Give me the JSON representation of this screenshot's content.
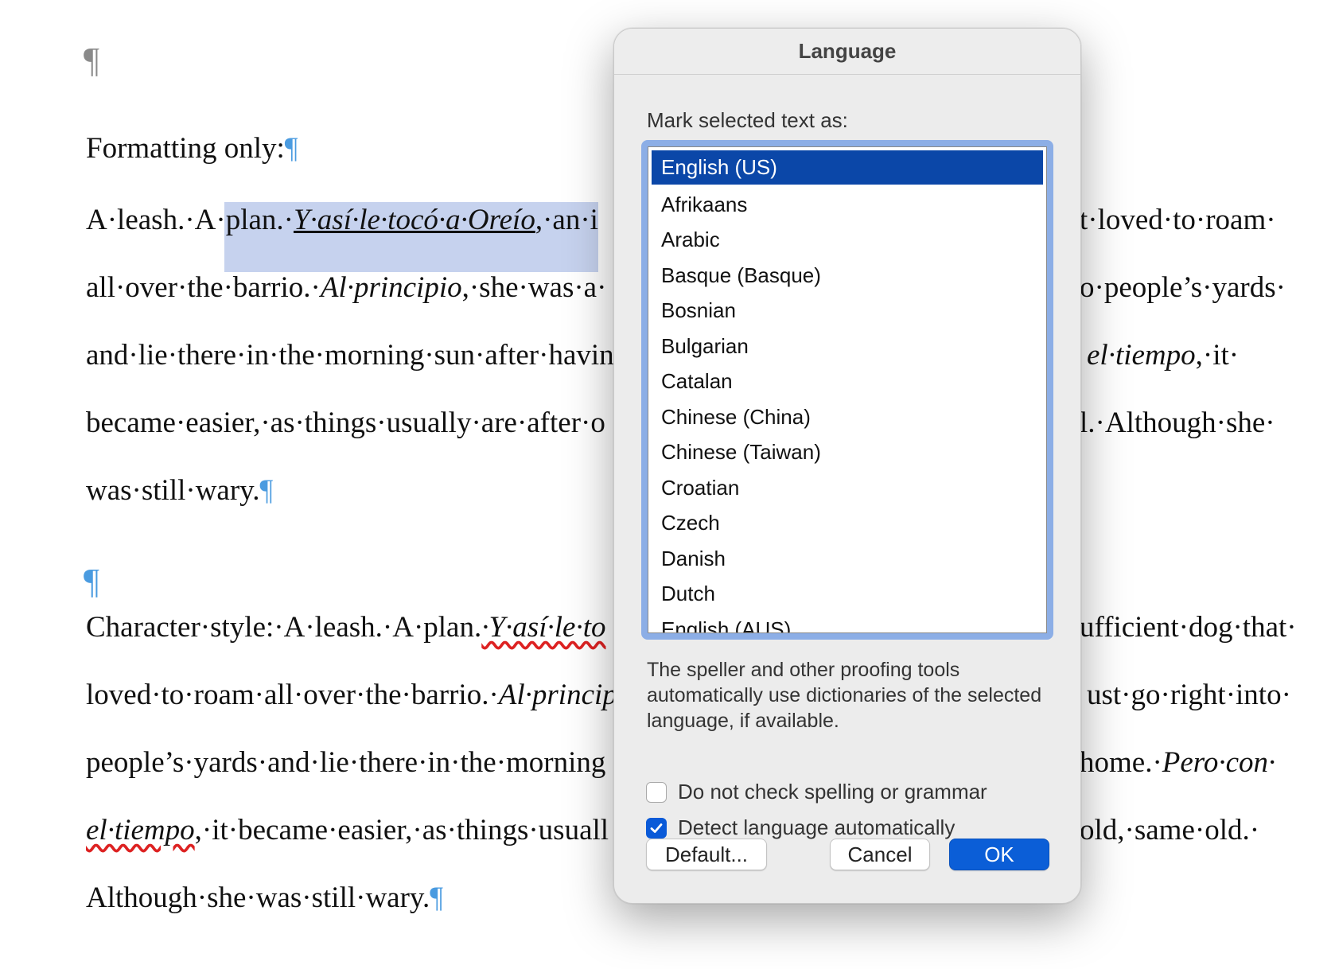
{
  "document": {
    "top_pilcrow": "¶",
    "heading": "Formatting only:",
    "para1": {
      "l1_a": "A·leash.·A·",
      "l1_sel_plain": "plan.·",
      "l1_sel_italic": "Y·así·le·tocó·a·Oreío",
      "l1_b": ",·an·i",
      "l1_right": "t·loved·to·roam·",
      "l2_a": "all·over·the·barrio.·",
      "l2_italic": "Al·principio",
      "l2_b": ",·she·was·a·",
      "l2_right": "o·people’s·yards·",
      "l3_a": "and·lie·there·in·the·morning·sun·after·havin",
      "l3_right_italic": "el·tiempo",
      "l3_right_b": ",·it·",
      "l4_a": "became·easier,·as·things·usually·are·after·o",
      "l4_right": "l.·Although·she·",
      "l5": "was·still·wary."
    },
    "blank_pilcrow": "¶",
    "para2": {
      "l1_a": "Character·style:·A·leash.·A·plan.",
      "l1_italic": "·Y·así·le·to",
      "l1_right": "ufficient·dog·that·",
      "l2_a": "loved·to·roam·all·over·the·barrio.·",
      "l2_italic": "Al·princip",
      "l2_right": "ust·go·right·into·",
      "l3_a": "people’s·yards·and·lie·there·in·the·morning",
      "l3_right": "home.·",
      "l3_right_italic": "Pero·con·",
      "l4_italic": "el·tiempo",
      "l4_b": ",·it·became·easier,·as·things·usuall",
      "l4_right": "old,·same·old.·",
      "l5": "Although·she·was·still·wary."
    },
    "pil": "¶"
  },
  "dialog": {
    "title": "Language",
    "prompt": "Mark selected text as:",
    "languages": [
      "English (US)",
      "Afrikaans",
      "Arabic",
      "Basque (Basque)",
      "Bosnian",
      "Bulgarian",
      "Catalan",
      "Chinese (China)",
      "Chinese (Taiwan)",
      "Croatian",
      "Czech",
      "Danish",
      "Dutch",
      "English (AUS)"
    ],
    "selected_language": "English (US)",
    "help_text": "The speller and other proofing tools automatically use dictionaries of the selected language, if available.",
    "check_no_spelling": {
      "label": "Do not check spelling or grammar",
      "checked": false
    },
    "check_detect": {
      "label": "Detect language automatically",
      "checked": true
    },
    "buttons": {
      "default": "Default...",
      "cancel": "Cancel",
      "ok": "OK"
    },
    "colors": {
      "accent": "#0b47a8",
      "button_primary": "#0b5ed7",
      "focus_ring": "#8caee6"
    }
  }
}
